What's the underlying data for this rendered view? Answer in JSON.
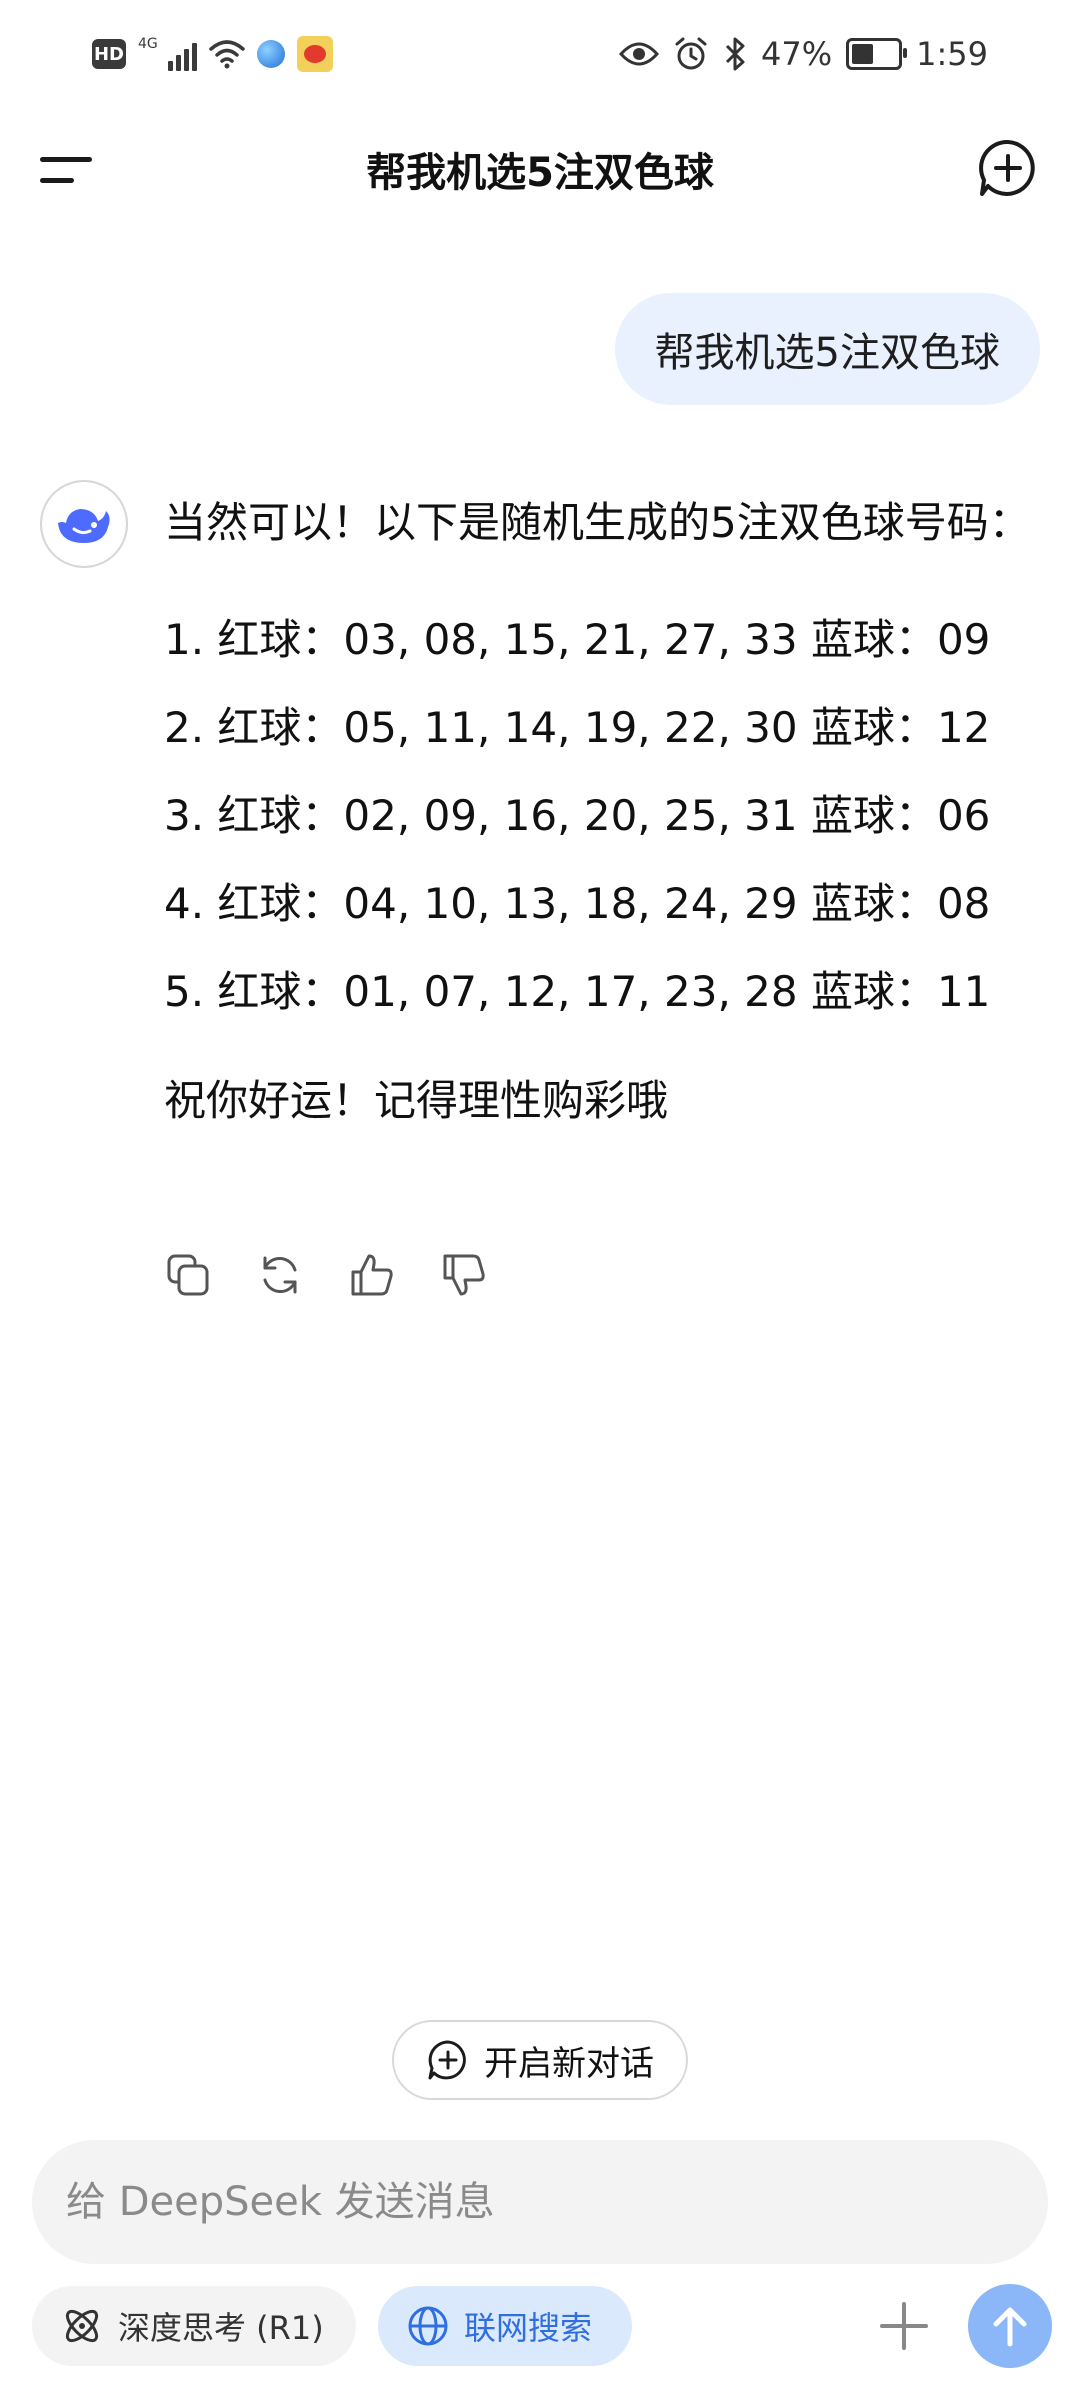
{
  "status_bar": {
    "hd": "HD",
    "network": "4G",
    "battery": "47%",
    "battery_level": 0.47,
    "time": "1:59"
  },
  "header": {
    "title": "帮我机选5注双色球"
  },
  "conversation": {
    "user_message": "帮我机选5注双色球",
    "assistant": {
      "intro": "当然可以！以下是随机生成的5注双色球号码：",
      "picks": [
        "1. 红球：03, 08, 15, 21, 27, 33 蓝球：09",
        "2. 红球：05, 11, 14, 19, 22, 30 蓝球：12",
        "3. 红球：02, 09, 16, 20, 25, 31 蓝球：06",
        "4. 红球：04, 10, 13, 18, 24, 29 蓝球：08",
        "5. 红球：01, 07, 12, 17, 23, 28 蓝球：11"
      ],
      "outro": "祝你好运！记得理性购彩哦"
    }
  },
  "new_conversation_label": "开启新对话",
  "input": {
    "placeholder": "给 DeepSeek 发送消息",
    "value": ""
  },
  "toolbar": {
    "deep_think_label": "深度思考 (R1)",
    "web_search_label": "联网搜索"
  },
  "colors": {
    "accent": "#2f6fe0",
    "user_bubble": "#eaf1fe",
    "send_button": "#8bb7f8",
    "logo": "#4d6bfe"
  },
  "icons": [
    "menu-icon",
    "new-chat-icon",
    "deepseek-whale-icon",
    "copy-icon",
    "regenerate-icon",
    "thumbs-up-icon",
    "thumbs-down-icon",
    "plus-circle-icon",
    "atom-icon",
    "globe-icon",
    "plus-icon",
    "arrow-up-icon"
  ]
}
